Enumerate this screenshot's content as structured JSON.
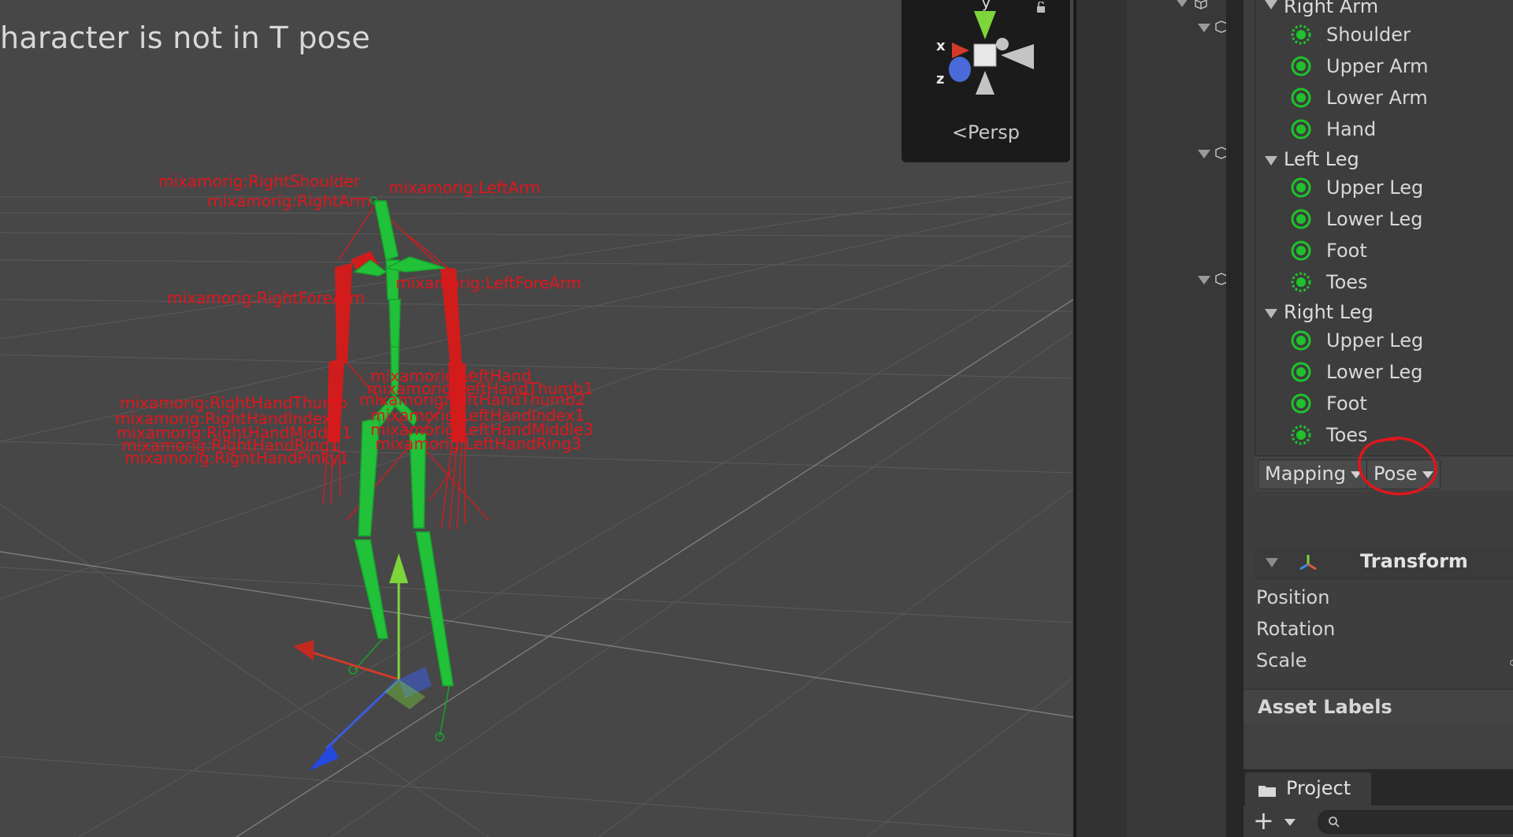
{
  "scene": {
    "warning": "haracter is not in T pose",
    "camera_mode": "Persp",
    "axis_labels": {
      "x": "x",
      "y": "y",
      "z": "z"
    },
    "bone_labels": [
      "mixamorig:RightShoulder",
      "mixamorig:RightArm",
      "mixamorig:LeftArm",
      "mixamorig:RightForeArm",
      "mixamorig:LeftForeArm",
      "mixamorig:LeftHand",
      "mixamorig:LeftHandThumb1",
      "mixamorig:RightHandThumb",
      "mixamorig:LeftHandThumb2",
      "mixamorig:RightHandIndex1",
      "mixamorig:LeftHandIndex1",
      "mixamorig:RightHandMiddle1",
      "mixamorig:LeftHandMiddle3",
      "mixamorig:RightHandRing1",
      "mixamorig:LeftHandRing3",
      "mixamorig:RightHandPinky1"
    ]
  },
  "inspector": {
    "avatar_mapping": [
      {
        "type": "group",
        "label": "Right Arm"
      },
      {
        "type": "bone",
        "label": "Shoulder",
        "optional": true
      },
      {
        "type": "bone",
        "label": "Upper Arm",
        "optional": false
      },
      {
        "type": "bone",
        "label": "Lower Arm",
        "optional": false
      },
      {
        "type": "bone",
        "label": "Hand",
        "optional": false
      },
      {
        "type": "group",
        "label": "Left Leg"
      },
      {
        "type": "bone",
        "label": "Upper Leg",
        "optional": false
      },
      {
        "type": "bone",
        "label": "Lower Leg",
        "optional": false
      },
      {
        "type": "bone",
        "label": "Foot",
        "optional": false
      },
      {
        "type": "bone",
        "label": "Toes",
        "optional": true
      },
      {
        "type": "group",
        "label": "Right Leg"
      },
      {
        "type": "bone",
        "label": "Upper Leg",
        "optional": false
      },
      {
        "type": "bone",
        "label": "Lower Leg",
        "optional": false
      },
      {
        "type": "bone",
        "label": "Foot",
        "optional": false
      },
      {
        "type": "bone",
        "label": "Toes",
        "optional": true
      }
    ],
    "mapping_button": "Mapping",
    "pose_button": "Pose",
    "transform": {
      "title": "Transform",
      "position_label": "Position",
      "rotation_label": "Rotation",
      "scale_label": "Scale"
    },
    "asset_labels": "Asset Labels"
  },
  "project": {
    "tab_label": "Project",
    "add_label": "+"
  },
  "colors": {
    "bone_ok": "#1fc22c",
    "bone_error": "#ff1a1a",
    "annotation": "#e0161c",
    "axis_x": "#d23a2a",
    "axis_y": "#7cd63a",
    "axis_z": "#3a5ce0"
  }
}
